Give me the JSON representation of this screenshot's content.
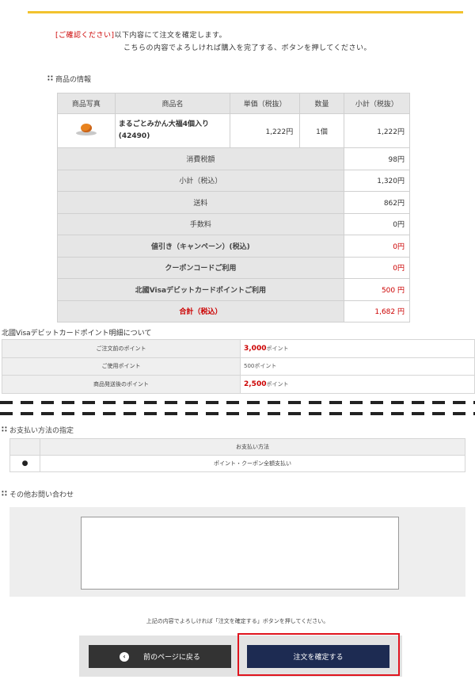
{
  "notice": {
    "tag": "[ご確認ください]",
    "line1": "以下内容にて注文を確定します。",
    "line2": "こちらの内容でよろしければ購入を完了する、ボタンを押してください。"
  },
  "product_section": {
    "title": "商品の情報",
    "headers": [
      "商品写真",
      "商品名",
      "単価（税抜）",
      "数量",
      "小計（税抜）"
    ],
    "item": {
      "name": "まるごとみかん大福4個入り",
      "code": "(42490)",
      "unit_price": "1,222円",
      "quantity": "1個",
      "subtotal": "1,222円"
    },
    "summary": [
      {
        "label": "消費税額",
        "value": "98円"
      },
      {
        "label": "小計（税込）",
        "value": "1,320円"
      },
      {
        "label": "送料",
        "value": "862円"
      },
      {
        "label": "手数料",
        "value": "0円"
      },
      {
        "label": "値引き（キャンペーン）(税込)",
        "value": "0円"
      },
      {
        "label": "クーポンコードご利用",
        "value": "0円"
      },
      {
        "label": "北國Visaデビットカードポイントご利用",
        "value": "500 円"
      },
      {
        "label": "合計（税込）",
        "value": "1,682 円"
      }
    ]
  },
  "points_section": {
    "title": "北國Visaデビットカードポイント明細について",
    "rows": [
      {
        "label": "ご注文前のポイント",
        "value": "3,000",
        "unit": "ポイント"
      },
      {
        "label": "ご使用ポイント",
        "value": "500",
        "unit": "ポイント"
      },
      {
        "label": "商品発送後のポイント",
        "value": "2,500",
        "unit": "ポイント"
      }
    ]
  },
  "payment_section": {
    "title": "お支払い方法の指定",
    "header": "お支払い方法",
    "selected_marker": "●",
    "method": "ポイント・クーポン全額支払い"
  },
  "inquiry_section": {
    "title": "その他お問い合わせ",
    "value": ""
  },
  "confirm_note": "上記の内容でよろしければ「注文を確定する」ボタンを押してください。",
  "buttons": {
    "back": "前のページに戻る",
    "back_icon": "‹",
    "confirm": "注文を確定する"
  },
  "colors": {
    "accent_line": "#f2c22e",
    "alert_red": "#cc0000",
    "confirm_button": "#1d2b52",
    "back_button": "#333333",
    "highlight_border": "#e0141e"
  }
}
